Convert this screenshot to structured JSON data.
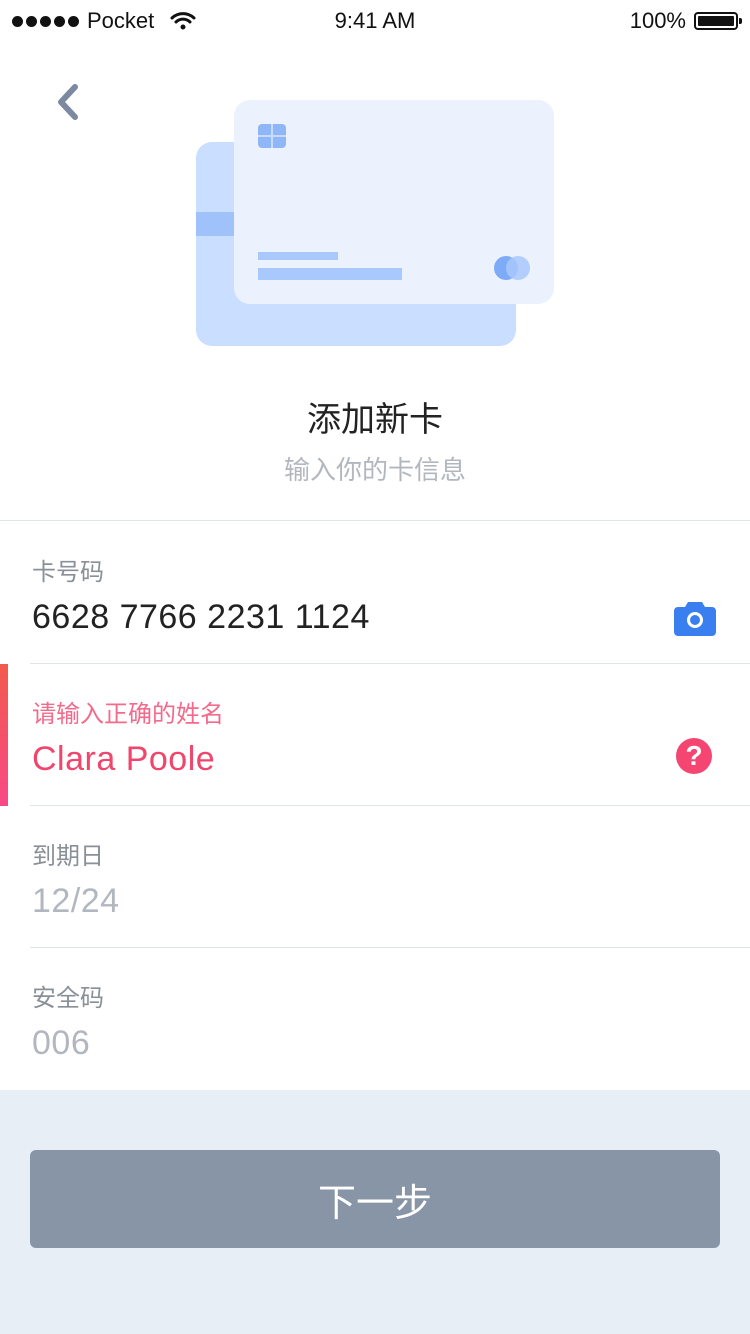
{
  "status_bar": {
    "carrier": "Pocket",
    "time": "9:41 AM",
    "battery": "100%"
  },
  "header": {
    "title": "添加新卡",
    "subtitle": "输入你的卡信息"
  },
  "fields": {
    "card_number": {
      "label": "卡号码",
      "value": "6628 7766 2231 1124"
    },
    "name": {
      "label": "请输入正确的姓名",
      "value": "Clara Poole"
    },
    "expiry": {
      "label": "到期日",
      "value": "12/24"
    },
    "cvv": {
      "label": "安全码",
      "value": "006"
    }
  },
  "footer": {
    "next_label": "下一步"
  },
  "icons": {
    "back": "chevron-left-icon",
    "camera": "camera-icon",
    "help": "question-icon"
  },
  "colors": {
    "accent": "#3a7ff0",
    "error": "#f0466b",
    "button": "#8795a6",
    "footer_bg": "#e8eef6"
  }
}
